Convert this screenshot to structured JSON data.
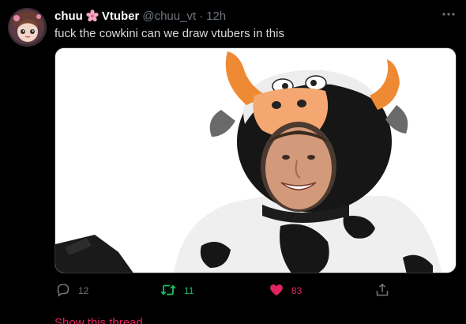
{
  "author": {
    "display_name": "chuu",
    "display_name_suffix": "Vtuber",
    "emoji": "sakura-icon",
    "handle": "@chuu_vt",
    "separator": "·",
    "time": "12h"
  },
  "tweet": {
    "text": "fuck the cowkini can we draw vtubers in this"
  },
  "actions": {
    "reply_count": "12",
    "retweet_count": "11",
    "like_count": "83",
    "liked": true,
    "retweeted": true
  },
  "thread_link": "Show this thread",
  "colors": {
    "background": "#000000",
    "text": "#d9d9d9",
    "muted": "#6e767d",
    "retweet_green": "#17bf63",
    "like_pink": "#e0245e"
  }
}
